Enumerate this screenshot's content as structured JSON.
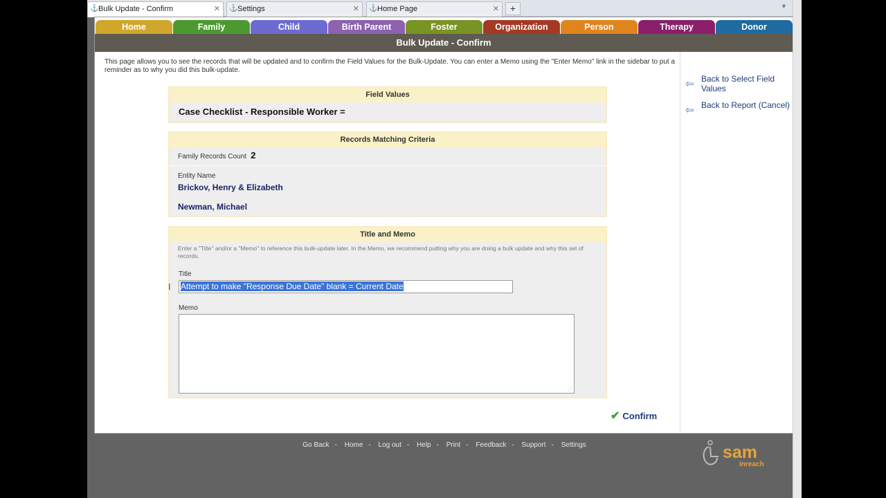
{
  "browser_tabs": [
    {
      "label": "Bulk Update - Confirm",
      "active": true
    },
    {
      "label": "Settings",
      "active": false
    },
    {
      "label": "Home Page",
      "active": false
    }
  ],
  "new_tab_label": "+",
  "nav": [
    {
      "label": "Home",
      "color": "#d1a72a"
    },
    {
      "label": "Family",
      "color": "#4b9a2f"
    },
    {
      "label": "Child",
      "color": "#6d6bd0"
    },
    {
      "label": "Birth Parent",
      "color": "#8d62b0"
    },
    {
      "label": "Foster",
      "color": "#7a9325"
    },
    {
      "label": "Organization",
      "color": "#a43a24"
    },
    {
      "label": "Person",
      "color": "#e0851b"
    },
    {
      "label": "Therapy",
      "color": "#8a1f6c"
    },
    {
      "label": "Donor",
      "color": "#1f6aa0"
    }
  ],
  "page_title": "Bulk Update - Confirm",
  "intro_text": "This page allows you to see the records that will be updated and to confirm the Field Values for the Bulk-Update. You can enter a Memo using the \"Enter Memo\" link in the sidebar to put a reminder as to why you did this bulk-update.",
  "sidebar": [
    {
      "label": "Back to Select Field Values",
      "icon": "back-arrow-icon"
    },
    {
      "label": "Back to Report (Cancel)",
      "icon": "back-arrow-icon"
    }
  ],
  "field_values": {
    "heading": "Field Values",
    "row": "Case Checklist - Responsible Worker  ="
  },
  "records": {
    "heading": "Records Matching Criteria",
    "count_label": "Family Records Count",
    "count": "2",
    "entity_label": "Entity Name",
    "entities": [
      "Brickov, Henry & Elizabeth",
      "Newman, Michael"
    ]
  },
  "title_memo": {
    "heading": "Title and Memo",
    "help": "Enter a \"Title\" and/or a \"Memo\" to reference this bulk-update later. In the Memo, we recommend putting why you are doing a bulk update and why this set of records.",
    "title_label": "Title",
    "title_value": "Attempt to make \"Response Due Date\" blank = Current Date",
    "memo_label": "Memo",
    "memo_value": ""
  },
  "confirm_label": "Confirm",
  "footer_links": [
    "Go Back",
    "Home",
    "Log out",
    "Help",
    "Print",
    "Feedback",
    "Support",
    "Settings"
  ],
  "footer_sep": "-",
  "logo_text": {
    "main": "sam",
    "sub": "inreach"
  },
  "colors": {
    "logo": "#e8a338"
  }
}
